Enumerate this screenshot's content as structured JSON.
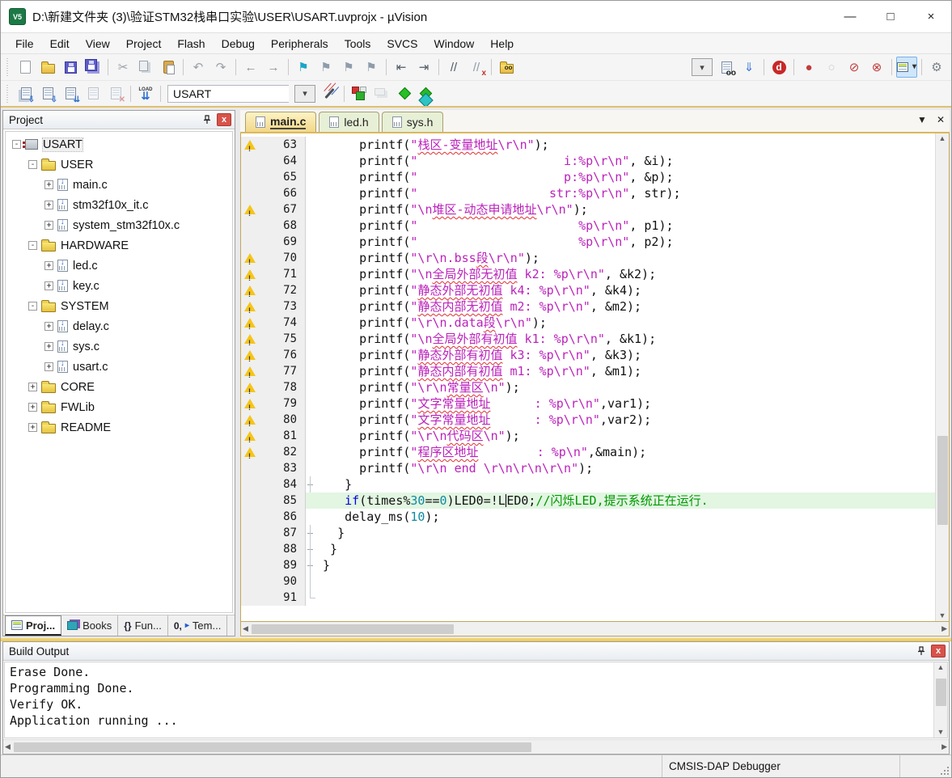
{
  "window": {
    "title": "D:\\新建文件夹 (3)\\验证STM32栈串口实验\\USER\\USART.uvprojx - µVision",
    "controls": [
      {
        "name": "minimize",
        "glyph": "—"
      },
      {
        "name": "maximize",
        "glyph": "□"
      },
      {
        "name": "close",
        "glyph": "×"
      }
    ]
  },
  "menubar": {
    "items": [
      "File",
      "Edit",
      "View",
      "Project",
      "Flash",
      "Debug",
      "Peripherals",
      "Tools",
      "SVCS",
      "Window",
      "Help"
    ]
  },
  "toolbar1": [
    {
      "type": "grip"
    },
    {
      "name": "new-file"
    },
    {
      "name": "open-folder"
    },
    {
      "name": "save"
    },
    {
      "name": "save-all"
    },
    {
      "type": "sep"
    },
    {
      "name": "cut",
      "g": "✂",
      "c": "#9aa0a6"
    },
    {
      "name": "copy"
    },
    {
      "name": "paste"
    },
    {
      "type": "sep"
    },
    {
      "name": "undo",
      "g": "↶",
      "c": "#9aa0a6"
    },
    {
      "name": "redo",
      "g": "↷",
      "c": "#9aa0a6"
    },
    {
      "type": "sep"
    },
    {
      "name": "navigate-back",
      "g": "←",
      "c": "#8a9096"
    },
    {
      "name": "navigate-forward",
      "g": "→",
      "c": "#8a9096"
    },
    {
      "type": "sep"
    },
    {
      "name": "insert-bookmark",
      "g": "⚑",
      "c": "#18a6c8"
    },
    {
      "name": "previous-bookmark",
      "g": "⚑",
      "c": "#8e9cab"
    },
    {
      "name": "next-bookmark",
      "g": "⚑",
      "c": "#8e9cab"
    },
    {
      "name": "clear-bookmarks",
      "g": "⚑",
      "c": "#8e9cab"
    },
    {
      "type": "sep"
    },
    {
      "name": "unindent",
      "g": "⇤",
      "c": "#4e5a66"
    },
    {
      "name": "indent",
      "g": "⇥",
      "c": "#4e5a66"
    },
    {
      "type": "sep"
    },
    {
      "name": "comment-selection",
      "g": "//",
      "c": "#4e5a66"
    },
    {
      "name": "uncomment-selection",
      "g": "//",
      "c": "#8e9cab",
      "g2": "x",
      "c2": "#c03030"
    },
    {
      "type": "sep"
    },
    {
      "name": "find-in-files-folder"
    },
    {
      "type": "spring"
    },
    {
      "type": "search-combo"
    },
    {
      "name": "find-in-files",
      "cls": "sheet-ic",
      "g2": "oo",
      "c2": "#222"
    },
    {
      "name": "incremental-find",
      "g": "⇓",
      "c": "#3b78d8"
    },
    {
      "type": "sep"
    },
    {
      "name": "find-text",
      "g": "d"
    },
    {
      "type": "sep"
    },
    {
      "name": "insert-breakpoint",
      "g": "●",
      "c": "#c23b3b"
    },
    {
      "name": "enable-breakpoint",
      "g": "○",
      "c": "#c8ccd0"
    },
    {
      "name": "disable-all-breakpoints",
      "g": "⊘",
      "c": "#c23b3b"
    },
    {
      "name": "kill-all-breakpoints",
      "g": "⊗",
      "c": "#c23b3b"
    },
    {
      "type": "sep"
    },
    {
      "name": "window-selector",
      "active": true,
      "g2": "▾"
    },
    {
      "type": "sep"
    },
    {
      "name": "configure",
      "g": "⚙",
      "c": "#7a828a"
    }
  ],
  "toolbar2": [
    {
      "type": "grip"
    },
    {
      "name": "translate-file",
      "cls": "sheet-ic",
      "g2": "⇩"
    },
    {
      "name": "build-target",
      "cls": "sheet-ic",
      "g2": "⇩"
    },
    {
      "name": "rebuild-target",
      "cls": "sheet-ic",
      "g2": "⇊"
    },
    {
      "name": "batch-build",
      "cls": "sheet-ic",
      "disabled": true
    },
    {
      "name": "stop-build",
      "cls": "sheet-ic",
      "disabled": true,
      "g2": "✕"
    },
    {
      "type": "sep"
    },
    {
      "name": "download",
      "g": "LOAD",
      "g2": "⇊"
    },
    {
      "type": "sep"
    },
    {
      "type": "target-combo"
    },
    {
      "type": "search-combo"
    },
    {
      "name": "options-for-target"
    },
    {
      "type": "sep"
    },
    {
      "name": "manage-run-time-environment"
    },
    {
      "name": "manage-project-items",
      "disabled": true
    },
    {
      "name": "select-software-packs"
    },
    {
      "name": "pack-installer"
    }
  ],
  "target_select": {
    "value": "USART"
  },
  "project_panel": {
    "title": "Project",
    "tree": [
      {
        "label": "USART",
        "icon": "target",
        "level": 0,
        "expander": "-",
        "selected": true
      },
      {
        "label": "USER",
        "icon": "folder",
        "level": 1,
        "expander": "-"
      },
      {
        "label": "main.c",
        "icon": "file",
        "level": 2,
        "expander": "+"
      },
      {
        "label": "stm32f10x_it.c",
        "icon": "file",
        "level": 2,
        "expander": "+"
      },
      {
        "label": "system_stm32f10x.c",
        "icon": "file",
        "level": 2,
        "expander": "+"
      },
      {
        "label": "HARDWARE",
        "icon": "folder",
        "level": 1,
        "expander": "-"
      },
      {
        "label": "led.c",
        "icon": "file",
        "level": 2,
        "expander": "+"
      },
      {
        "label": "key.c",
        "icon": "file",
        "level": 2,
        "expander": "+"
      },
      {
        "label": "SYSTEM",
        "icon": "folder",
        "level": 1,
        "expander": "-"
      },
      {
        "label": "delay.c",
        "icon": "file",
        "level": 2,
        "expander": "+"
      },
      {
        "label": "sys.c",
        "icon": "file",
        "level": 2,
        "expander": "+"
      },
      {
        "label": "usart.c",
        "icon": "file",
        "level": 2,
        "expander": "+"
      },
      {
        "label": "CORE",
        "icon": "folder",
        "level": 1,
        "expander": "+"
      },
      {
        "label": "FWLib",
        "icon": "folder",
        "level": 1,
        "expander": "+"
      },
      {
        "label": "README",
        "icon": "folder",
        "level": 1,
        "expander": "+"
      }
    ],
    "bottom_tabs": [
      {
        "label": "Proj...",
        "icon": "project",
        "active": true
      },
      {
        "label": "Books",
        "icon": "books"
      },
      {
        "label": "Fun...",
        "icon": "functions",
        "g": "{}"
      },
      {
        "label": "Tem...",
        "icon": "templates",
        "g": "0,",
        "g2": "▸"
      }
    ]
  },
  "editor": {
    "tabs": [
      {
        "label": "main.c",
        "active": true
      },
      {
        "label": "led.h"
      },
      {
        "label": "sys.h"
      }
    ],
    "lines": [
      {
        "n": 63,
        "w": 1,
        "seg": [
          [
            "p",
            "      printf("
          ],
          [
            "s",
            "\""
          ],
          [
            "zs",
            "栈区-变量地址"
          ],
          [
            "s",
            "\\r\\n\""
          ],
          [
            "p",
            ");"
          ]
        ]
      },
      {
        "n": 64,
        "seg": [
          [
            "p",
            "      printf("
          ],
          [
            "s",
            "\"                    i:%p\\r\\n\""
          ],
          [
            "p",
            ", &i);"
          ]
        ]
      },
      {
        "n": 65,
        "seg": [
          [
            "p",
            "      printf("
          ],
          [
            "s",
            "\"                    p:%p\\r\\n\""
          ],
          [
            "p",
            ", &p);"
          ]
        ]
      },
      {
        "n": 66,
        "seg": [
          [
            "p",
            "      printf("
          ],
          [
            "s",
            "\"                  str:%p\\r\\n\""
          ],
          [
            "p",
            ", str);"
          ]
        ]
      },
      {
        "n": 67,
        "w": 1,
        "seg": [
          [
            "p",
            "      printf("
          ],
          [
            "s",
            "\"\\n"
          ],
          [
            "zs",
            "堆区-动态申请地址"
          ],
          [
            "s",
            "\\r\\n\""
          ],
          [
            "p",
            ");"
          ]
        ]
      },
      {
        "n": 68,
        "seg": [
          [
            "p",
            "      printf("
          ],
          [
            "s",
            "\"                      %p\\r\\n\""
          ],
          [
            "p",
            ", p1);"
          ]
        ]
      },
      {
        "n": 69,
        "seg": [
          [
            "p",
            "      printf("
          ],
          [
            "s",
            "\"                      %p\\r\\n\""
          ],
          [
            "p",
            ", p2);"
          ]
        ]
      },
      {
        "n": 70,
        "w": 1,
        "seg": [
          [
            "p",
            "      printf("
          ],
          [
            "s",
            "\"\\r\\n.bss"
          ],
          [
            "zs",
            "段"
          ],
          [
            "s",
            "\\r\\n\""
          ],
          [
            "p",
            ");"
          ]
        ]
      },
      {
        "n": 71,
        "w": 1,
        "seg": [
          [
            "p",
            "      printf("
          ],
          [
            "s",
            "\"\\n"
          ],
          [
            "zs",
            "全局外部无初值"
          ],
          [
            "s",
            " k2: %p\\r\\n\""
          ],
          [
            "p",
            ", &k2);"
          ]
        ]
      },
      {
        "n": 72,
        "w": 1,
        "seg": [
          [
            "p",
            "      printf("
          ],
          [
            "s",
            "\""
          ],
          [
            "zs",
            "静态外部无初值"
          ],
          [
            "s",
            " k4: %p\\r\\n\""
          ],
          [
            "p",
            ", &k4);"
          ]
        ]
      },
      {
        "n": 73,
        "w": 1,
        "seg": [
          [
            "p",
            "      printf("
          ],
          [
            "s",
            "\""
          ],
          [
            "zs",
            "静态内部无初值"
          ],
          [
            "s",
            " m2: %p\\r\\n\""
          ],
          [
            "p",
            ", &m2);"
          ]
        ]
      },
      {
        "n": 74,
        "w": 1,
        "seg": [
          [
            "p",
            "      printf("
          ],
          [
            "s",
            "\"\\r\\n.data"
          ],
          [
            "zs",
            "段"
          ],
          [
            "s",
            "\\r\\n\""
          ],
          [
            "p",
            ");"
          ]
        ]
      },
      {
        "n": 75,
        "w": 1,
        "seg": [
          [
            "p",
            "      printf("
          ],
          [
            "s",
            "\"\\n"
          ],
          [
            "zs",
            "全局外部有初值"
          ],
          [
            "s",
            " k1: %p\\r\\n\""
          ],
          [
            "p",
            ", &k1);"
          ]
        ]
      },
      {
        "n": 76,
        "w": 1,
        "seg": [
          [
            "p",
            "      printf("
          ],
          [
            "s",
            "\""
          ],
          [
            "zs",
            "静态外部有初值"
          ],
          [
            "s",
            " k3: %p\\r\\n\""
          ],
          [
            "p",
            ", &k3);"
          ]
        ]
      },
      {
        "n": 77,
        "w": 1,
        "seg": [
          [
            "p",
            "      printf("
          ],
          [
            "s",
            "\""
          ],
          [
            "zs",
            "静态内部有初值"
          ],
          [
            "s",
            " m1: %p\\r\\n\""
          ],
          [
            "p",
            ", &m1);"
          ]
        ]
      },
      {
        "n": 78,
        "w": 1,
        "seg": [
          [
            "p",
            "      printf("
          ],
          [
            "s",
            "\"\\r\\n"
          ],
          [
            "zs",
            "常量区"
          ],
          [
            "s",
            "\\n\""
          ],
          [
            "p",
            ");"
          ]
        ]
      },
      {
        "n": 79,
        "w": 1,
        "seg": [
          [
            "p",
            "      printf("
          ],
          [
            "s",
            "\""
          ],
          [
            "zs",
            "文字常量地址"
          ],
          [
            "s",
            "      : %p\\r\\n\""
          ],
          [
            "p",
            ",var1);"
          ]
        ]
      },
      {
        "n": 80,
        "w": 1,
        "seg": [
          [
            "p",
            "      printf("
          ],
          [
            "s",
            "\""
          ],
          [
            "zs",
            "文字常量地址"
          ],
          [
            "s",
            "      : %p\\r\\n\""
          ],
          [
            "p",
            ",var2);"
          ]
        ]
      },
      {
        "n": 81,
        "w": 1,
        "seg": [
          [
            "p",
            "      printf("
          ],
          [
            "s",
            "\"\\r\\n"
          ],
          [
            "zs",
            "代码区"
          ],
          [
            "s",
            "\\n\""
          ],
          [
            "p",
            ");"
          ]
        ]
      },
      {
        "n": 82,
        "w": 1,
        "seg": [
          [
            "p",
            "      printf("
          ],
          [
            "s",
            "\""
          ],
          [
            "zs",
            "程序区地址"
          ],
          [
            "s",
            "        : %p\\n\""
          ],
          [
            "p",
            ",&main);"
          ]
        ]
      },
      {
        "n": 83,
        "seg": [
          [
            "p",
            "      printf("
          ],
          [
            "s",
            "\"\\r\\n end \\r\\n\\r\\n\\r\\n\""
          ],
          [
            "p",
            ");"
          ]
        ]
      },
      {
        "n": 84,
        "m": "t",
        "seg": [
          [
            "p",
            "    }"
          ]
        ]
      },
      {
        "n": 85,
        "hl": 1,
        "seg": [
          [
            "p",
            "    "
          ],
          [
            "k",
            "if"
          ],
          [
            "p",
            "(times%"
          ],
          [
            "n",
            "30"
          ],
          [
            "p",
            "=="
          ],
          [
            "n",
            "0"
          ],
          [
            "p",
            ")LED0=!L"
          ],
          [
            "cur",
            ""
          ],
          [
            "p",
            "ED0;"
          ],
          [
            "c",
            "//闪烁LED,提示系统正在运行."
          ]
        ]
      },
      {
        "n": 86,
        "seg": [
          [
            "p",
            "    delay_ms("
          ],
          [
            "n",
            "10"
          ],
          [
            "p",
            ");"
          ]
        ]
      },
      {
        "n": 87,
        "m": "t",
        "seg": [
          [
            "p",
            "   }"
          ]
        ]
      },
      {
        "n": 88,
        "m": "t",
        "seg": [
          [
            "p",
            "  }"
          ]
        ]
      },
      {
        "n": 89,
        "m": "t",
        "seg": [
          [
            "p",
            " }"
          ]
        ]
      },
      {
        "n": 90,
        "m": "v",
        "seg": []
      },
      {
        "n": 91,
        "m": "c",
        "seg": []
      }
    ]
  },
  "build_output": {
    "title": "Build Output",
    "lines": [
      "Erase Done.",
      "Programming Done.",
      "Verify OK.",
      "Application running ..."
    ]
  },
  "statusbar": {
    "debugger": "CMSIS-DAP Debugger"
  },
  "colors": {
    "string": "#bb22bb",
    "keyword": "#0000e0",
    "number": "#0f8aa0",
    "comment": "#009800",
    "highlight_line": "#e2f6e2",
    "tab_active": "#f2d788",
    "tab_inactive": "#e7f0d6",
    "warning": "#f5c518"
  }
}
